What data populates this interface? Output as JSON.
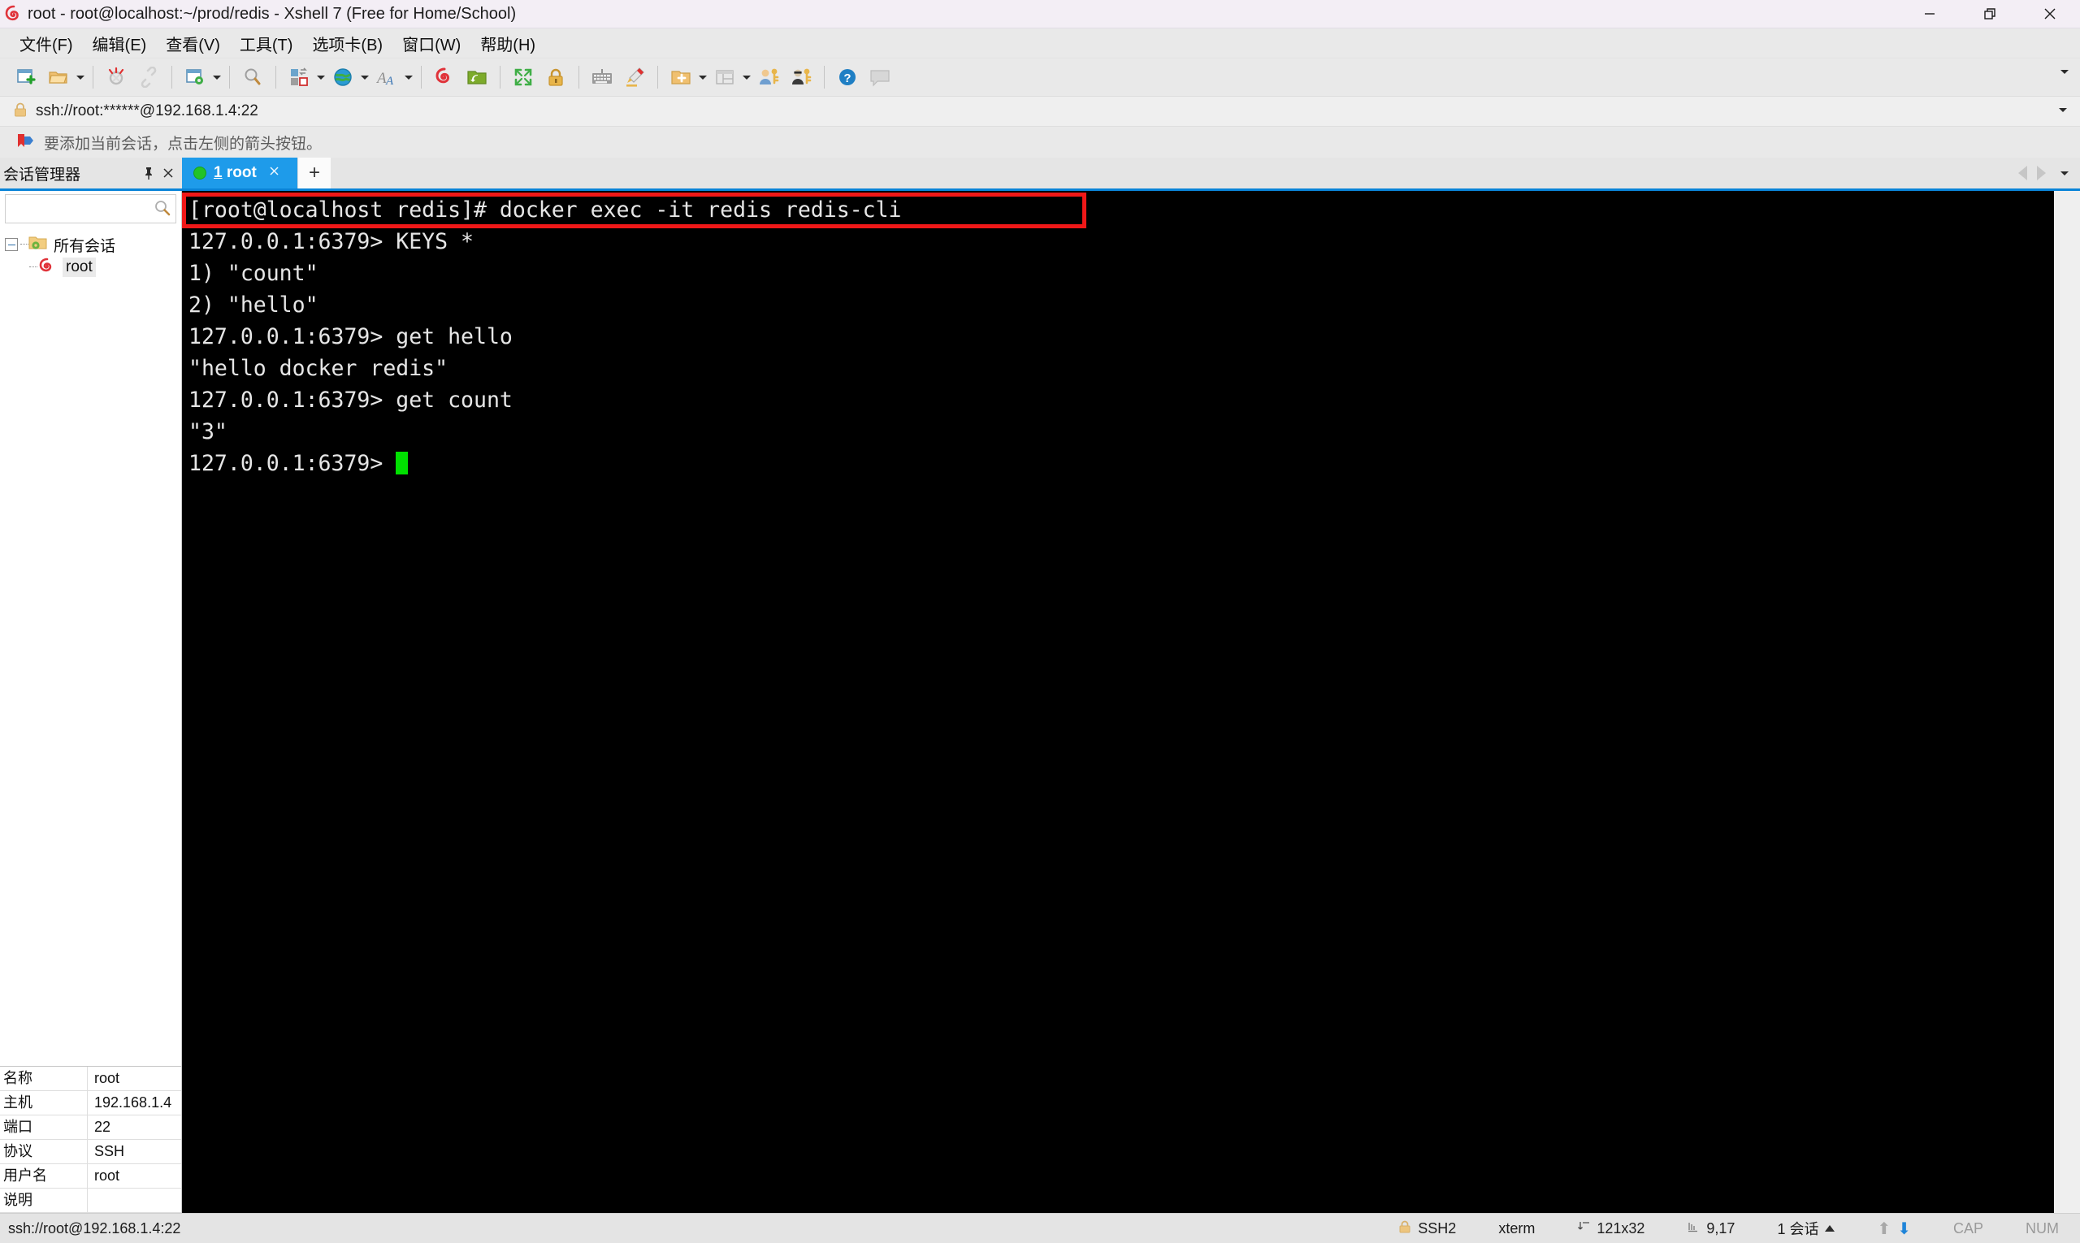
{
  "window": {
    "title": "root - root@localhost:~/prod/redis - Xshell 7 (Free for Home/School)",
    "app_icon": "xshell-icon",
    "minimize_label": "—",
    "maximize_label": "❐",
    "close_label": "✕"
  },
  "menubar": {
    "items": [
      {
        "label": "文件(F)",
        "name": "menu-file"
      },
      {
        "label": "编辑(E)",
        "name": "menu-edit"
      },
      {
        "label": "查看(V)",
        "name": "menu-view"
      },
      {
        "label": "工具(T)",
        "name": "menu-tools"
      },
      {
        "label": "选项卡(B)",
        "name": "menu-tabs"
      },
      {
        "label": "窗口(W)",
        "name": "menu-window"
      },
      {
        "label": "帮助(H)",
        "name": "menu-help"
      }
    ]
  },
  "toolbar": {
    "overflow_label": "▼",
    "items": [
      {
        "name": "new-session-icon",
        "glyph": "new"
      },
      {
        "name": "open-folder-icon",
        "glyph": "folder"
      },
      {
        "name": "disconnect-icon",
        "glyph": "disconnect"
      },
      {
        "name": "reconnect-icon",
        "glyph": "link"
      },
      {
        "name": "session-properties-icon",
        "glyph": "props"
      },
      {
        "name": "find-icon",
        "glyph": "search"
      },
      {
        "name": "layout-icon",
        "glyph": "layout"
      },
      {
        "name": "globe-encoding-icon",
        "glyph": "globe"
      },
      {
        "name": "font-icon",
        "glyph": "font"
      },
      {
        "name": "xshell-icon",
        "glyph": "xshell"
      },
      {
        "name": "xftp-icon",
        "glyph": "xftp"
      },
      {
        "name": "fullscreen-icon",
        "glyph": "fullscreen"
      },
      {
        "name": "lock-icon",
        "glyph": "lock"
      },
      {
        "name": "keyboard-icon",
        "glyph": "keyboard"
      },
      {
        "name": "highlight-pen-icon",
        "glyph": "pen"
      },
      {
        "name": "new-folder-icon",
        "glyph": "newfolder"
      },
      {
        "name": "split-view-icon",
        "glyph": "split"
      },
      {
        "name": "user-key-icon",
        "glyph": "userkey"
      },
      {
        "name": "agent-key-icon",
        "glyph": "agentkey"
      },
      {
        "name": "help-icon",
        "glyph": "help"
      },
      {
        "name": "chat-icon",
        "glyph": "chat"
      }
    ]
  },
  "addressbar": {
    "icon": "lock-icon",
    "value": "ssh://root:******@192.168.1.4:22",
    "dropdown_label": "▼"
  },
  "notice": {
    "icon": "bookmark-arrow-icon",
    "text": "要添加当前会话，点击左侧的箭头按钮。"
  },
  "session_manager": {
    "title": "会话管理器",
    "pin_label": "📌",
    "close_label": "✕",
    "search": {
      "value": "",
      "placeholder": "",
      "icon": "search-icon"
    },
    "tree": [
      {
        "label": "所有会话",
        "icon": "folder-sessions-icon",
        "level": 0,
        "expanded": true,
        "selected": false
      },
      {
        "label": "root",
        "icon": "xshell-session-icon",
        "level": 1,
        "expanded": false,
        "selected": true
      }
    ],
    "properties": [
      {
        "key": "名称",
        "value": "root"
      },
      {
        "key": "主机",
        "value": "192.168.1.4"
      },
      {
        "key": "端口",
        "value": "22"
      },
      {
        "key": "协议",
        "value": "SSH"
      },
      {
        "key": "用户名",
        "value": "root"
      },
      {
        "key": "说明",
        "value": ""
      }
    ]
  },
  "tabs": {
    "items": [
      {
        "index": "1",
        "label": " root",
        "status": "connected",
        "close_label": "✕"
      }
    ],
    "new_tab_label": "+",
    "scroll_left_label": "◀",
    "scroll_right_label": "▶",
    "menu_label": "▼"
  },
  "terminal": {
    "lines": [
      {
        "text": "[root@localhost redis]# docker exec -it redis redis-cli",
        "highlighted": true
      },
      {
        "text": "127.0.0.1:6379> KEYS *",
        "highlighted": false
      },
      {
        "text": "1) \"count\"",
        "highlighted": false
      },
      {
        "text": "2) \"hello\"",
        "highlighted": false
      },
      {
        "text": "127.0.0.1:6379> get hello",
        "highlighted": false
      },
      {
        "text": "\"hello docker redis\"",
        "highlighted": false
      },
      {
        "text": "127.0.0.1:6379> get count",
        "highlighted": false
      },
      {
        "text": "\"3\"",
        "highlighted": false
      },
      {
        "text": "127.0.0.1:6379> ",
        "highlighted": false,
        "cursor": true
      }
    ],
    "highlight_color": "#f01818",
    "cursor_color": "#00e000",
    "background": "#000000",
    "foreground": "#e6e6e6"
  },
  "statusbar": {
    "connection": "ssh://root@192.168.1.4:22",
    "security": "SSH2",
    "security_icon": "lock-icon",
    "term_type": "xterm",
    "size_icon": "resize-icon",
    "size": "121x32",
    "cursor_icon": "cursor-icon",
    "cursor_pos": "9,17",
    "sessions": "1 会话",
    "sessions_caret": "▲",
    "upload_icon": "arrow-up-icon",
    "download_icon": "arrow-down-icon",
    "caps": "CAP",
    "num": "NUM"
  }
}
